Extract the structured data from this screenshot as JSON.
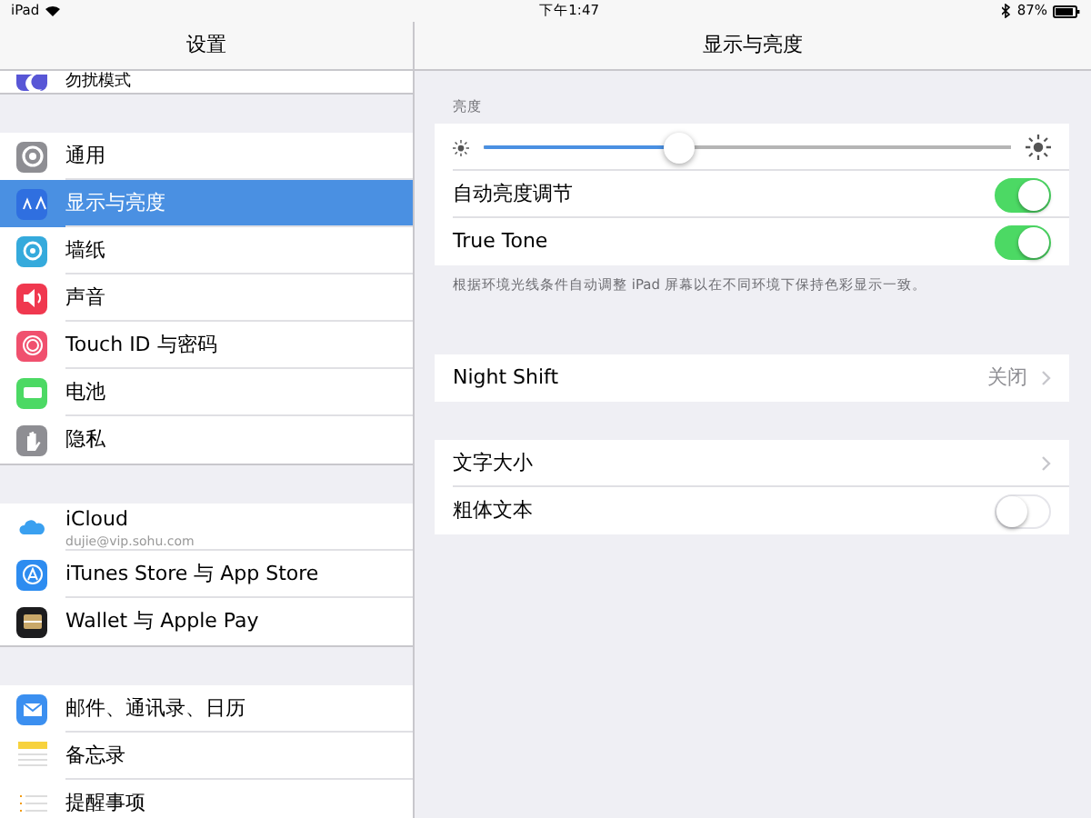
{
  "status_bar": {
    "device": "iPad",
    "time": "下午1:47",
    "battery": "87%"
  },
  "sidebar": {
    "title": "设置",
    "groups": [
      [
        {
          "label": "勿扰模式",
          "kind": "moon",
          "color": "#5856d6",
          "selected": false
        }
      ],
      [
        {
          "label": "通用",
          "kind": "gear",
          "color": "#8e8e93",
          "selected": false
        },
        {
          "label": "显示与亮度",
          "kind": "text",
          "color": "#2f6fe0",
          "selected": true
        },
        {
          "label": "墙纸",
          "kind": "flower",
          "color": "#35aadc",
          "selected": false
        },
        {
          "label": "声音",
          "kind": "speaker",
          "color": "#f0384f",
          "selected": false
        },
        {
          "label": "Touch ID 与密码",
          "kind": "finger",
          "color": "#f0506e",
          "selected": false
        },
        {
          "label": "电池",
          "kind": "battery",
          "color": "#4cd964",
          "selected": false
        },
        {
          "label": "隐私",
          "kind": "hand",
          "color": "#8e8e93",
          "selected": false
        }
      ],
      [
        {
          "label": "iCloud",
          "subtitle": "dujie@vip.sohu.com",
          "kind": "cloud",
          "color": "#ffffff",
          "selected": false
        },
        {
          "label": "iTunes Store 与 App Store",
          "kind": "store",
          "color": "#2d8cf0",
          "selected": false
        },
        {
          "label": "Wallet 与 Apple Pay",
          "kind": "wallet",
          "color": "#1c1c1e",
          "selected": false
        }
      ],
      [
        {
          "label": "邮件、通讯录、日历",
          "kind": "mail",
          "color": "#3b8ff0",
          "selected": false
        },
        {
          "label": "备忘录",
          "kind": "notes",
          "color": "#ffffff",
          "selected": false
        },
        {
          "label": "提醒事项",
          "kind": "list",
          "color": "#ffffff",
          "selected": false
        }
      ]
    ]
  },
  "detail": {
    "title": "显示与亮度",
    "sections": [
      {
        "header": "亮度",
        "rows": [
          {
            "kind": "slider",
            "level": 0.37
          },
          {
            "kind": "toggle",
            "label": "自动亮度调节",
            "on": true
          },
          {
            "kind": "toggle",
            "label": "True Tone",
            "on": true
          }
        ],
        "footer": "根据环境光线条件自动调整 iPad 屏幕以在不同环境下保持色彩显示一致。"
      },
      {
        "rows": [
          {
            "kind": "link",
            "label": "Night Shift",
            "value": "关闭"
          }
        ]
      },
      {
        "rows": [
          {
            "kind": "link",
            "label": "文字大小"
          },
          {
            "kind": "toggle",
            "label": "粗体文本",
            "on": false
          }
        ]
      }
    ]
  }
}
